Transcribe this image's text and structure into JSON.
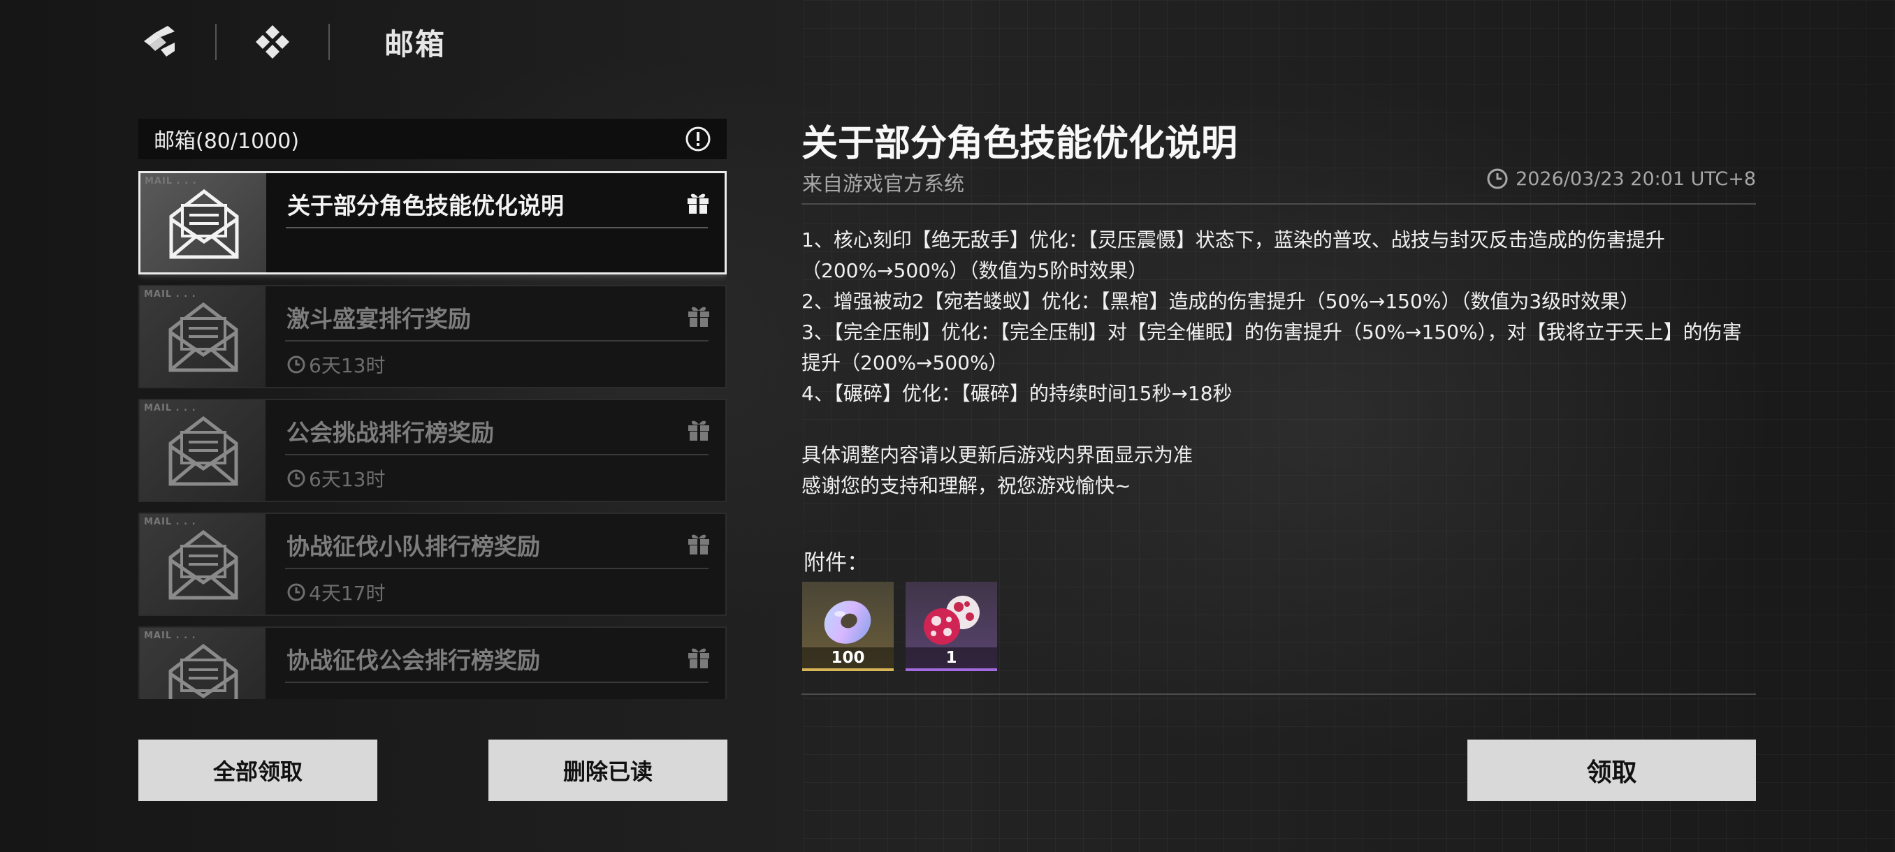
{
  "header": {
    "title": "邮箱"
  },
  "mailbox": {
    "count_label": "邮箱(80/1000)"
  },
  "mails": [
    {
      "title": "关于部分角色技能优化说明",
      "time": "",
      "selected": true
    },
    {
      "title": "激斗盛宴排行奖励",
      "time": "6天13时"
    },
    {
      "title": "公会挑战排行榜奖励",
      "time": "6天13时"
    },
    {
      "title": "协战征伐小队排行榜奖励",
      "time": "4天17时"
    },
    {
      "title": "协战征伐公会排行榜奖励",
      "time": ""
    }
  ],
  "buttons": {
    "claim_all": "全部领取",
    "delete_read": "删除已读",
    "claim": "领取"
  },
  "detail": {
    "title": "关于部分角色技能优化说明",
    "sender": "来自游戏官方系统",
    "timestamp": "2026/03/23 20:01 UTC+8",
    "body": [
      "1、核心刻印【绝无敌手】优化：【灵压震慑】状态下，蓝染的普攻、战技与封灭反击造成的伤害提升（200%→500%）（数值为5阶时效果）",
      "2、增强被动2【宛若蝼蚁】优化：【黑棺】造成的伤害提升（50%→150%）（数值为3级时效果）",
      "3、【完全压制】优化：【完全压制】对【完全催眠】的伤害提升（50%→150%），对【我将立于天上】的伤害提升（200%→500%）",
      "4、【碾碎】优化：【碾碎】的持续时间15秒→18秒",
      "",
      "具体调整内容请以更新后游戏内界面显示为准",
      "感谢您的支持和理解，祝您游戏愉快~"
    ],
    "attachments_label": "附件：",
    "attachments": [
      {
        "icon": "ring-crystal-icon",
        "quantity": "100",
        "rarity_color": "#d9b55a"
      },
      {
        "icon": "spotted-orbs-icon",
        "quantity": "1",
        "rarity_color": "#a36ae0"
      }
    ]
  }
}
